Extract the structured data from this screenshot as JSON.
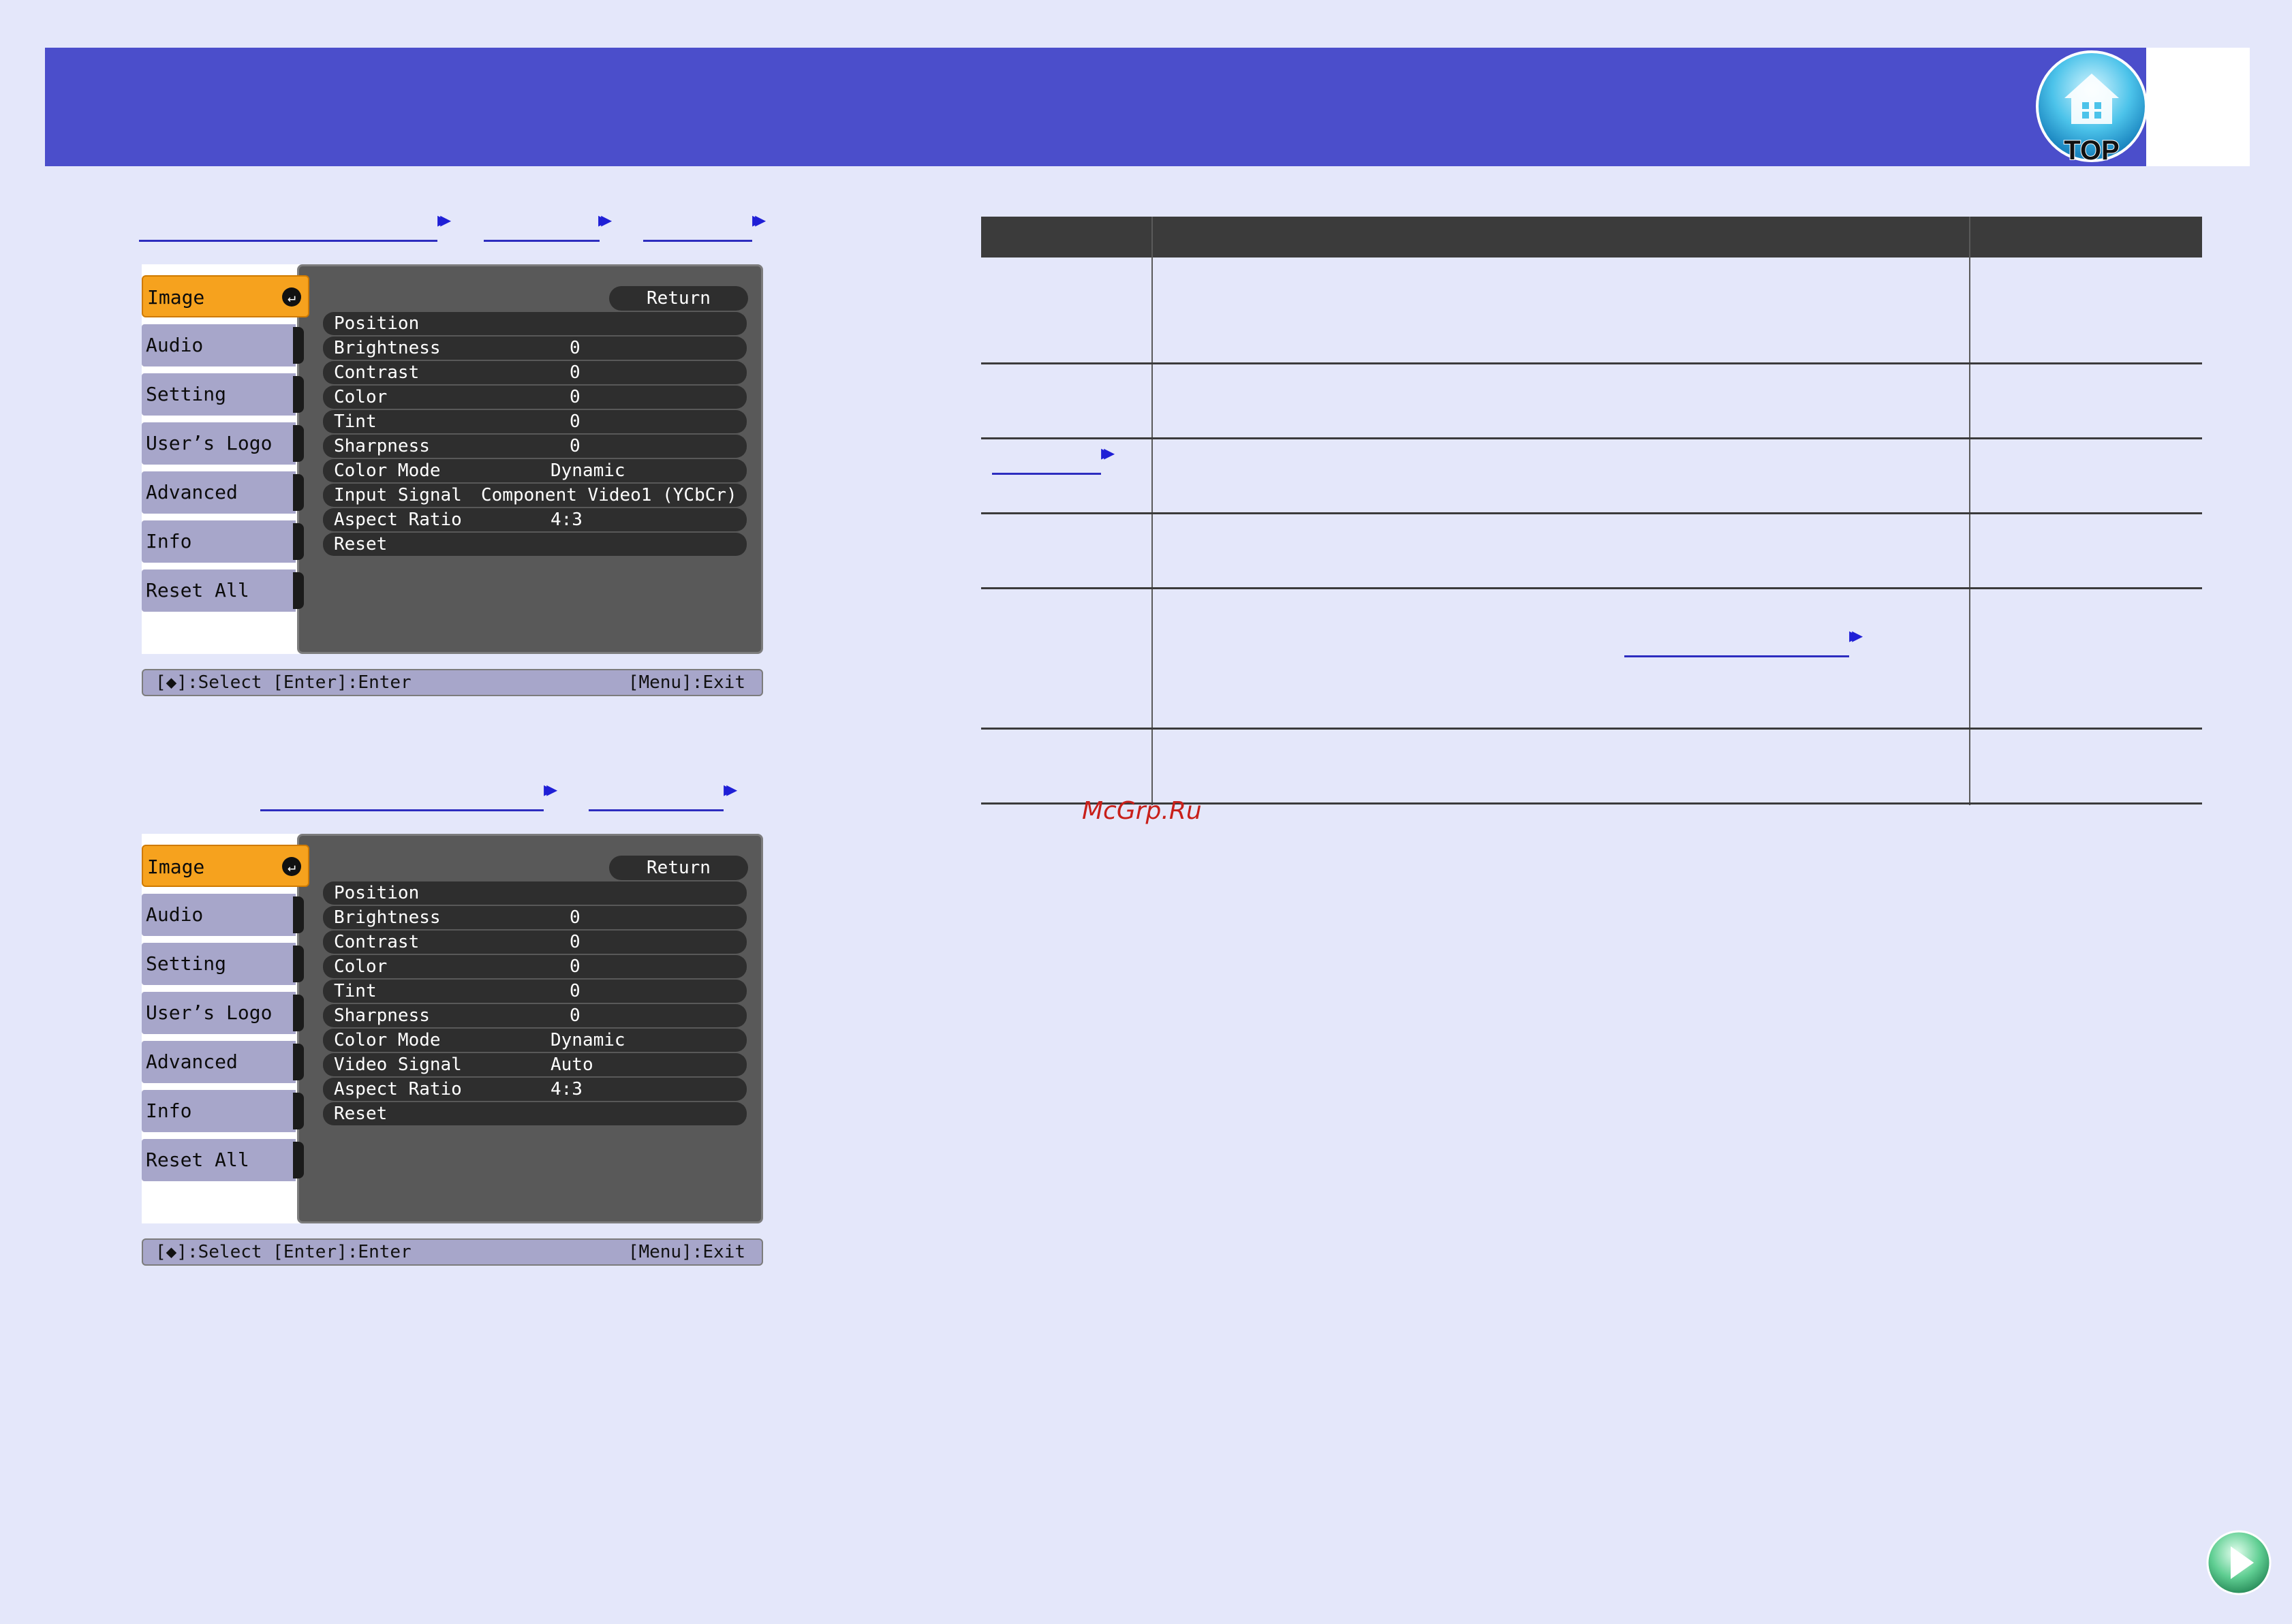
{
  "header": {
    "top_icon_label": "TOP",
    "colors": {
      "banner": "#4b4ecb",
      "background": "#e4e7fa"
    }
  },
  "menus": [
    {
      "sidebar": [
        "Image",
        "Audio",
        "Setting",
        "User’s Logo",
        "Advanced",
        "Info",
        "Reset All"
      ],
      "selected": "Image",
      "return_label": "Return",
      "rows": [
        {
          "label": "Position",
          "value": ""
        },
        {
          "label": "Brightness",
          "value": "0"
        },
        {
          "label": "Contrast",
          "value": "0"
        },
        {
          "label": "Color",
          "value": "0"
        },
        {
          "label": "Tint",
          "value": "0"
        },
        {
          "label": "Sharpness",
          "value": "0"
        },
        {
          "label": "Color Mode",
          "value": "Dynamic"
        },
        {
          "label": "Input Signal",
          "value": "Component Video1 (YCbCr)"
        },
        {
          "label": "Aspect Ratio",
          "value": "4:3"
        },
        {
          "label": "Reset",
          "value": ""
        }
      ],
      "status_left": "[◆]:Select [Enter]:Enter",
      "status_right": "[Menu]:Exit"
    },
    {
      "sidebar": [
        "Image",
        "Audio",
        "Setting",
        "User’s Logo",
        "Advanced",
        "Info",
        "Reset All"
      ],
      "selected": "Image",
      "return_label": "Return",
      "rows": [
        {
          "label": "Position",
          "value": ""
        },
        {
          "label": "Brightness",
          "value": "0"
        },
        {
          "label": "Contrast",
          "value": "0"
        },
        {
          "label": "Color",
          "value": "0"
        },
        {
          "label": "Tint",
          "value": "0"
        },
        {
          "label": "Sharpness",
          "value": "0"
        },
        {
          "label": "Color Mode",
          "value": "Dynamic"
        },
        {
          "label": "Video Signal",
          "value": "Auto"
        },
        {
          "label": "Aspect Ratio",
          "value": "4:3"
        },
        {
          "label": "Reset",
          "value": ""
        }
      ],
      "status_left": "[◆]:Select [Enter]:Enter",
      "status_right": "[Menu]:Exit"
    }
  ],
  "watermark": "McGrp.Ru",
  "icons": {
    "link_arrow": "double-chevron-right-icon",
    "next": "next-page-icon",
    "top": "home-top-icon"
  }
}
